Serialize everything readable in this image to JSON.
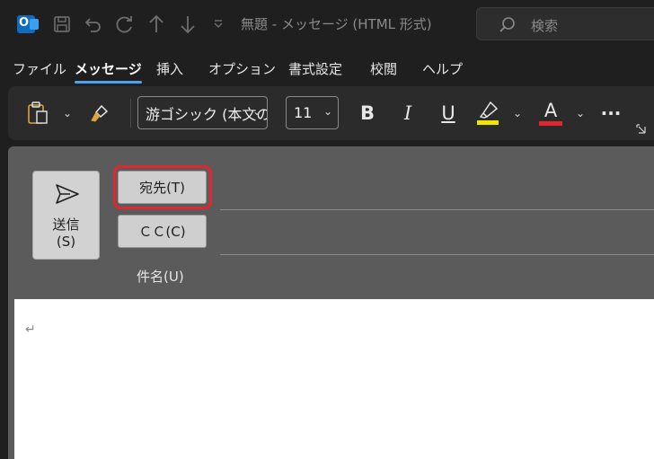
{
  "titlebar": {
    "title": "無題  -  メッセージ (HTML 形式)",
    "search_placeholder": "検索",
    "icons": [
      "outlook-icon",
      "save-icon",
      "undo-icon",
      "redo-icon",
      "up-arrow-icon",
      "down-arrow-icon",
      "customize-chevron-icon"
    ]
  },
  "menu": {
    "tabs": [
      "ファイル",
      "メッセージ",
      "挿入",
      "オプション",
      "書式設定",
      "校閲",
      "ヘルプ"
    ],
    "active": "メッセージ"
  },
  "ribbon": {
    "font_name": "游ゴシック (本文の",
    "font_size": "11",
    "bold": "B",
    "italic": "I",
    "underline": "U",
    "font_color_letter": "A",
    "more": "···",
    "colors": {
      "highlight": "#f2e600",
      "font_color": "#e0262e"
    }
  },
  "compose": {
    "send_label_line1": "送信",
    "send_label_line2": "(S)",
    "to_label": "宛先(T)",
    "cc_label": "ＣＣ(C)",
    "subject_label": "件名(U)",
    "body_mark": "↵"
  },
  "colors": {
    "accent": "#4aa3f0",
    "highlight_box": "#e0262e",
    "compose_bg": "#5b5b5b"
  }
}
